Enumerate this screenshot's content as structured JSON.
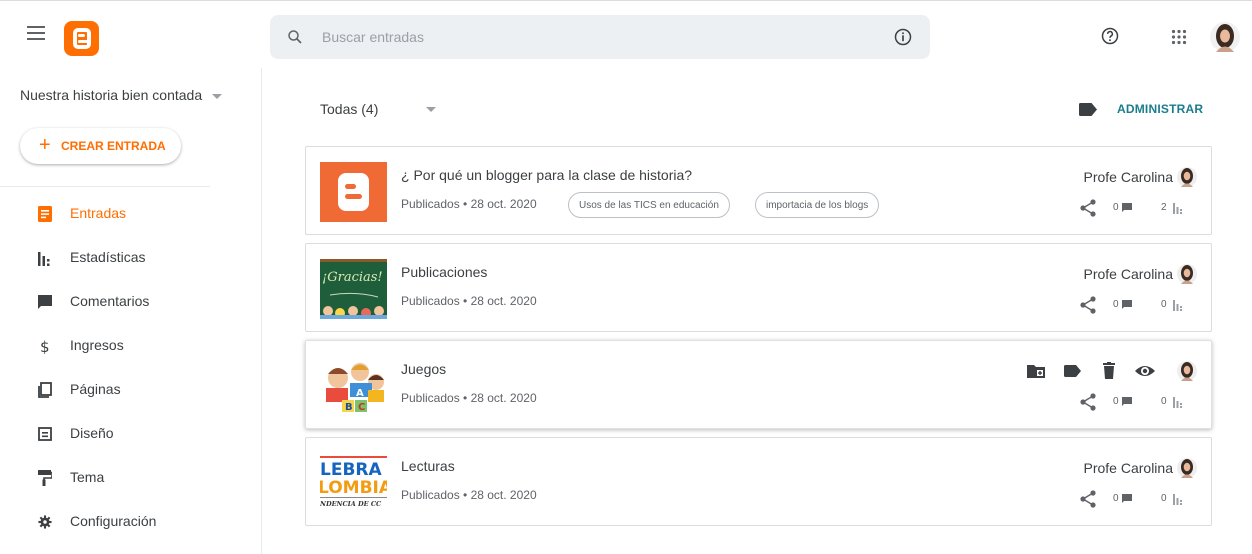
{
  "search": {
    "placeholder": "Buscar entradas"
  },
  "sidebar": {
    "blog_title": "Nuestra historia bien contada",
    "create_label": "CREAR ENTRADA",
    "items": [
      {
        "label": "Entradas",
        "icon": "posts-icon",
        "active": true
      },
      {
        "label": "Estadísticas",
        "icon": "stats-icon"
      },
      {
        "label": "Comentarios",
        "icon": "comments-icon"
      },
      {
        "label": "Ingresos",
        "icon": "dollar-icon"
      },
      {
        "label": "Páginas",
        "icon": "pages-icon"
      },
      {
        "label": "Diseño",
        "icon": "layout-icon"
      },
      {
        "label": "Tema",
        "icon": "paint-roller-icon"
      },
      {
        "label": "Configuración",
        "icon": "gear-icon"
      }
    ]
  },
  "main": {
    "filter_label": "Todas (4)",
    "admin_label": "ADMINISTRAR",
    "posts": [
      {
        "title": "¿ Por qué un blogger para la clase de historia?",
        "meta": "Publicados • 28 oct. 2020",
        "labels": [
          "Usos de las TICS en educación",
          "importacia de los blogs"
        ],
        "author": "Profe Carolina",
        "comments": "0",
        "views": "2"
      },
      {
        "title": "Publicaciones",
        "meta": "Publicados • 28 oct. 2020",
        "author": "Profe Carolina",
        "comments": "0",
        "views": "0",
        "thumb_text": "¡Gracias!"
      },
      {
        "title": "Juegos",
        "meta": "Publicados • 28 oct. 2020",
        "comments": "0",
        "views": "0"
      },
      {
        "title": "Lecturas",
        "meta": "Publicados • 28 oct. 2020",
        "author": "Profe Carolina",
        "comments": "0",
        "views": "0",
        "thumb_lines": [
          "LEBRA !",
          "LOMBIA",
          "NDENCIA DE CC"
        ]
      }
    ]
  },
  "colors": {
    "accent": "#ff6e00",
    "admin": "#1a7d8c",
    "chalkboard": "#1f5e3a"
  }
}
